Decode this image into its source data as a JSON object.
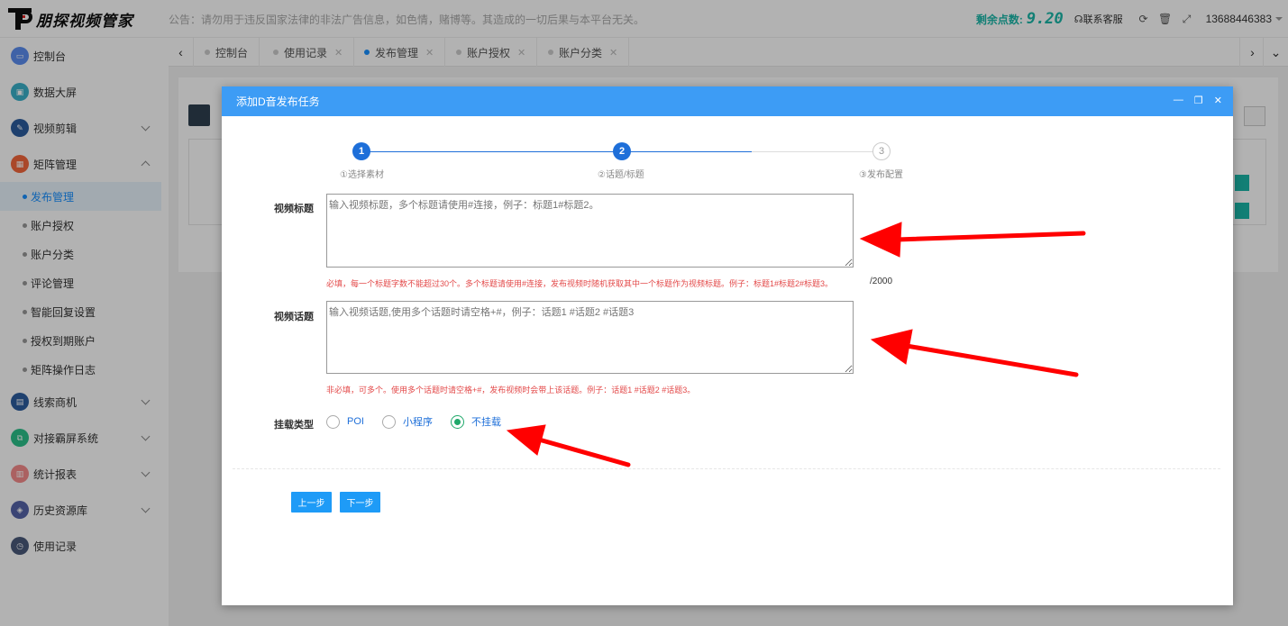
{
  "header": {
    "logo_text": "朋探视频管家",
    "notice": "公告：请勿用于违反国家法律的非法广告信息，如色情，赌博等。其造成的一切后果与本平台无关。",
    "points_label": "剩余点数:",
    "points_value": "9.20",
    "contact_service": "联系客服",
    "phone": "13688446383"
  },
  "sidebar": {
    "items": [
      {
        "label": "控制台",
        "color": "#5b8def"
      },
      {
        "label": "数据大屏",
        "color": "#3ab0c9"
      },
      {
        "label": "视频剪辑",
        "color": "#2b5c9e"
      },
      {
        "label": "矩阵管理",
        "color": "#f4663b"
      },
      {
        "label": "线索商机",
        "color": "#2b5c9e"
      },
      {
        "label": "对接霸屏系统",
        "color": "#2bc08a"
      },
      {
        "label": "统计报表",
        "color": "#f58b8b"
      },
      {
        "label": "历史资源库",
        "color": "#5563a8"
      },
      {
        "label": "使用记录",
        "color": "#4a5a7a"
      }
    ],
    "sub_items": [
      "发布管理",
      "账户授权",
      "账户分类",
      "评论管理",
      "智能回复设置",
      "授权到期账户",
      "矩阵操作日志"
    ]
  },
  "tabs": [
    "控制台",
    "使用记录",
    "发布管理",
    "账户授权",
    "账户分类"
  ],
  "modal": {
    "title": "添加D音发布任务",
    "steps": [
      {
        "num": "1",
        "label": "①选择素材"
      },
      {
        "num": "2",
        "label": "②话题/标题"
      },
      {
        "num": "3",
        "label": "③发布配置"
      }
    ],
    "title_field": {
      "label": "视频标题",
      "placeholder": "输入视频标题，多个标题请使用#连接，例子：标题1#标题2。",
      "hint": "必填，每一个标题字数不能超过30个。多个标题请使用#连接，发布视频时随机获取其中一个标题作为视频标题。例子：标题1#标题2#标题3。",
      "counter": "/2000"
    },
    "topic_field": {
      "label": "视频话题",
      "placeholder": "输入视频话题,使用多个话题时请空格+#，例子：话题1 #话题2 #话题3",
      "hint": "非必填，可多个。使用多个话题时请空格+#，发布视频时会带上该话题。例子：话题1 #话题2 #话题3。"
    },
    "mount": {
      "label": "挂载类型",
      "options": [
        "POI",
        "小程序",
        "不挂载"
      ],
      "selected": "不挂载"
    },
    "prev_button": "上一步",
    "next_button": "下一步"
  },
  "colors": {
    "primary": "#3d9cf5",
    "step_done": "#1e6fd9",
    "hint_red": "#e34a4a",
    "accent_teal": "#1ab7a8",
    "arrow_red": "#ff0000"
  }
}
